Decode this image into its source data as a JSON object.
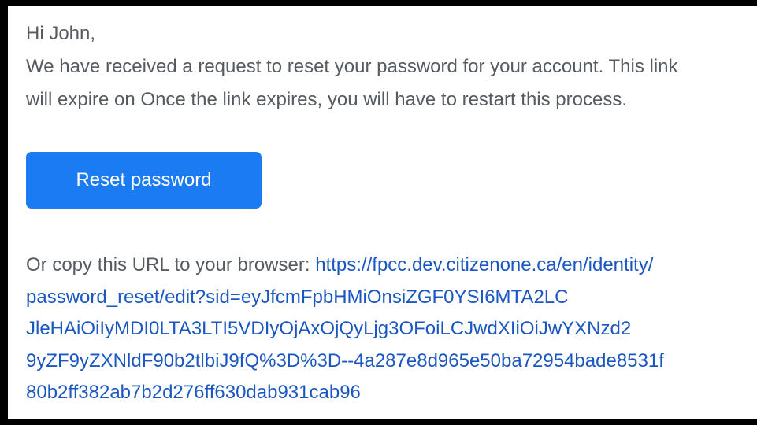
{
  "email": {
    "greeting": "Hi John,",
    "message_line_1": "We have received a request to reset your password for your account. This link",
    "message_line_2": "will expire on Once the link expires, you will have to restart this process.",
    "reset_button_label": "Reset password",
    "copy_url_prefix": "Or copy this URL to your browser: ",
    "url_lines": [
      "https://fpcc.dev.citizenone.ca/en/identity/",
      "password_reset/edit?sid=eyJfcmFpbHMiOnsiZGF0YSI6MTA2LC",
      "JleHAiOiIyMDI0LTA3LTI5VDIyOjAxOjQyLjg3OFoiLCJwdXIiOiJwYXNzd2",
      "9yZF9yZXNldF90b2tlbiJ9fQ%3D%3D--4a287e8d965e50ba72954bade8531f",
      "80b2ff382ab7b2d276ff630dab931cab96"
    ]
  },
  "colors": {
    "button_bg": "#1a7bf2",
    "link": "#1a57c0",
    "body_text": "#555b61"
  }
}
